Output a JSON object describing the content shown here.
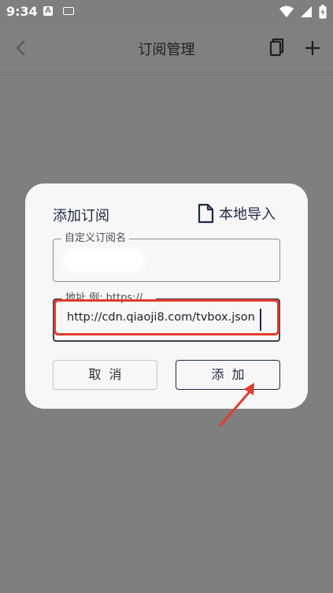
{
  "status_bar": {
    "time": "9:34",
    "notif_a": "A"
  },
  "app_bar": {
    "title": "订阅管理"
  },
  "dialog": {
    "title": "添加订阅",
    "import_label": "本地导入",
    "name_field": {
      "label": "自定义订阅名",
      "value": ""
    },
    "url_field": {
      "label": "地址 例: https://...",
      "value": "http://cdn.qiaoji8.com/tvbox.json"
    },
    "cancel_label": "取消",
    "add_label": "添加"
  },
  "colors": {
    "overlay": "#7f7f7f",
    "dialog": "#f7f7f8",
    "accent": "#1d2a44",
    "highlight": "#e23b2b"
  }
}
